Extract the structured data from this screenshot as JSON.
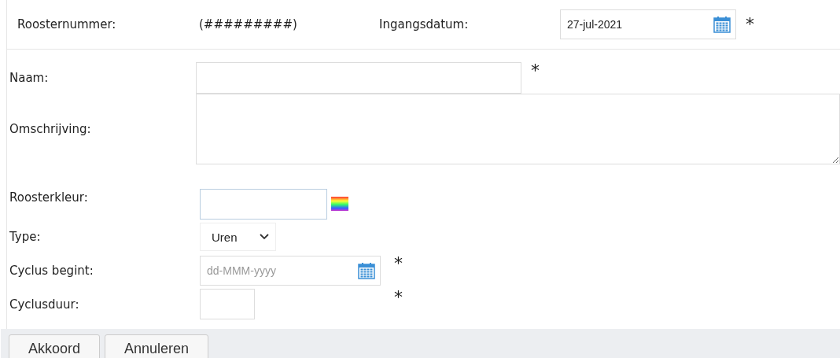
{
  "header": {
    "number_label": "Roosternummer:",
    "number_value": "(#########)",
    "date_label": "Ingangsdatum:",
    "date_value": "27-jul-2021",
    "required_mark": "*"
  },
  "fields": [
    {
      "kind": "text",
      "label": "Naam:",
      "required_mark": "*"
    },
    {
      "kind": "textarea",
      "label": "Omschrijving:"
    },
    {
      "kind": "color",
      "label": "Roosterkleur:"
    },
    {
      "kind": "select",
      "label": "Type:",
      "value": "Uren"
    },
    {
      "kind": "date",
      "label": "Cyclus begint:",
      "placeholder": "dd-MMM-yyyy",
      "required_mark": "*"
    },
    {
      "kind": "number",
      "label": "Cyclusduur:",
      "required_mark": "*"
    }
  ],
  "buttons": [
    "Akkoord",
    "Annuleren"
  ]
}
